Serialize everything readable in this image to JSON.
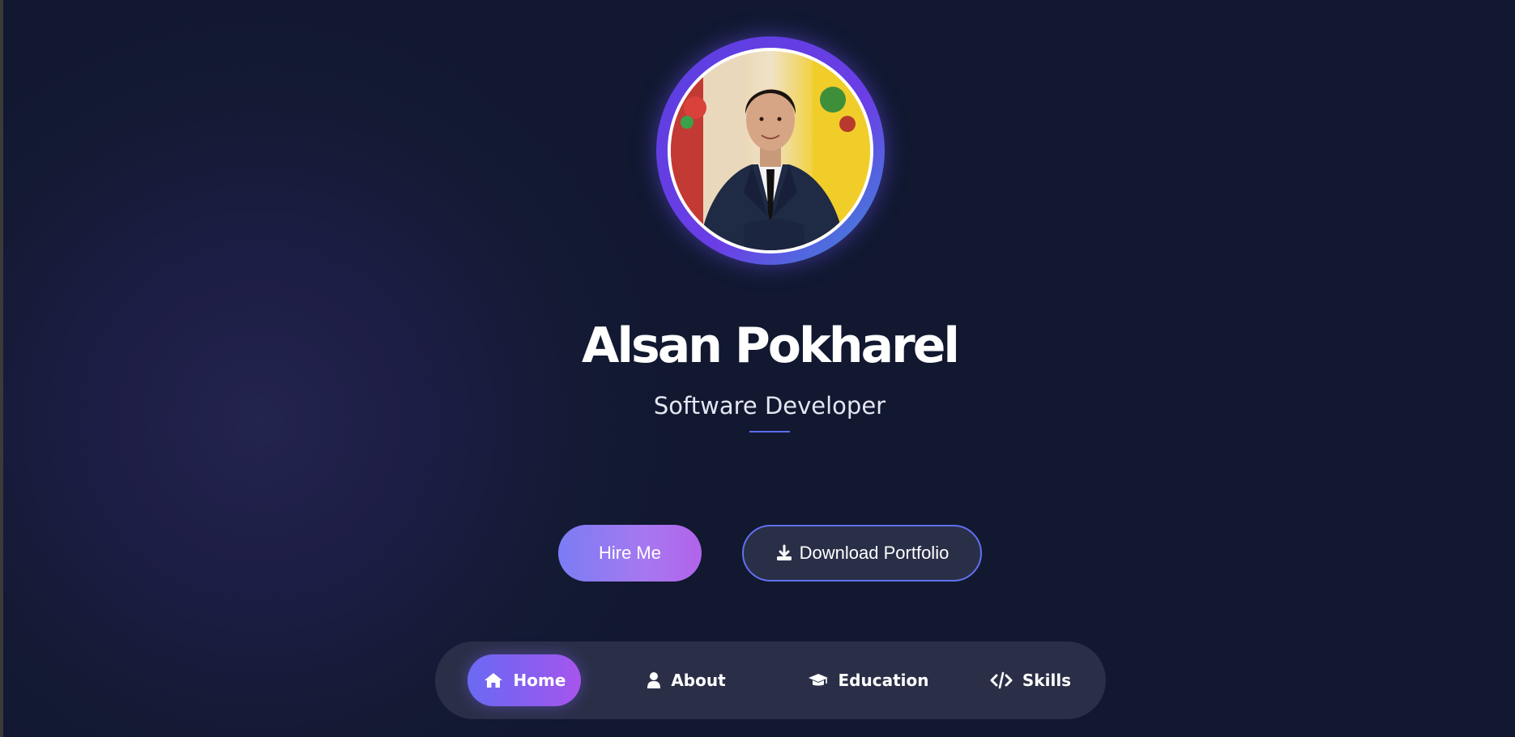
{
  "profile": {
    "name": "Alsan Pokharel",
    "role": "Software Developer"
  },
  "actions": {
    "hire_label": "Hire Me",
    "download_label": "Download Portfolio"
  },
  "nav": {
    "items": [
      {
        "label": "Home",
        "icon": "home-icon",
        "active": true
      },
      {
        "label": "About",
        "icon": "user-icon",
        "active": false
      },
      {
        "label": "Education",
        "icon": "graduation-cap-icon",
        "active": false
      },
      {
        "label": "Skills",
        "icon": "code-icon",
        "active": false
      }
    ]
  },
  "colors": {
    "background": "#141a34",
    "accent": "#6b6af2",
    "accent_secondary": "#a855ec",
    "avatar_ring": "#5b3fe0",
    "nav_background": "#2a2f47",
    "outline_button_border": "#6270f0"
  }
}
